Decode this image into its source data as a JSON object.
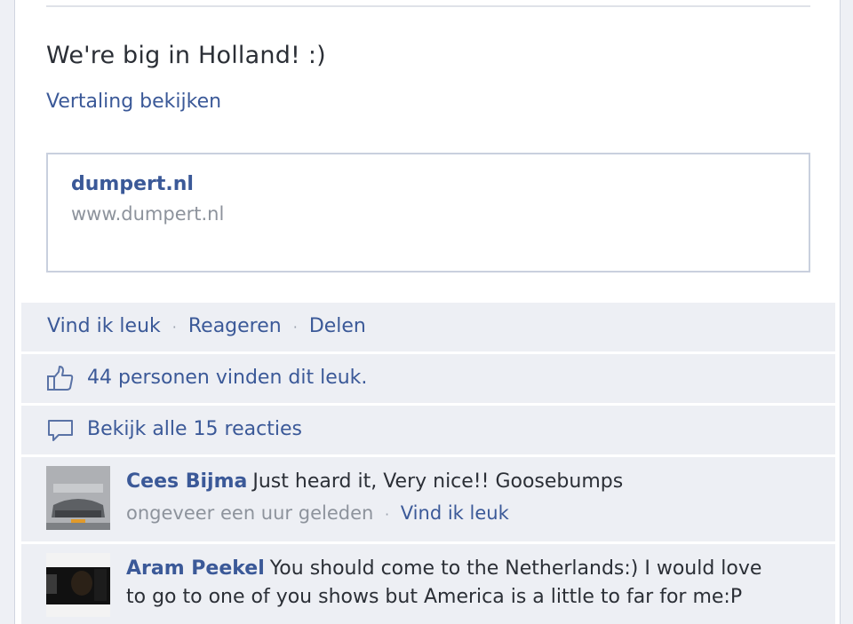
{
  "post": {
    "message": "We're big in Holland! :)",
    "translate_label": "Vertaling bekijken"
  },
  "link_preview": {
    "title": "dumpert.nl",
    "url": "www.dumpert.nl"
  },
  "actions": {
    "like_label": "Vind ik leuk",
    "comment_label": "Reageren",
    "share_label": "Delen",
    "separator": "·"
  },
  "likes": {
    "summary": "44 personen vinden dit leuk."
  },
  "comments_link": {
    "label": "Bekijk alle 15 reacties"
  },
  "comments": [
    {
      "author": "Cees Bijma",
      "text": "Just heard it, Very nice!! Goosebumps",
      "time": "ongeveer een uur geleden",
      "like_label": "Vind ik leuk"
    },
    {
      "author": "Aram Peekel",
      "text": "You should come to the Netherlands:) I would love to go to one of you shows but America is a little to far for me:P",
      "time": "",
      "like_label": ""
    }
  ],
  "colors": {
    "link_blue": "#3b5998",
    "feedback_bg": "#edeff4",
    "muted_text": "#8d939c"
  },
  "icons": {
    "like": "thumbs-up-icon",
    "comments": "speech-bubble-icon"
  }
}
